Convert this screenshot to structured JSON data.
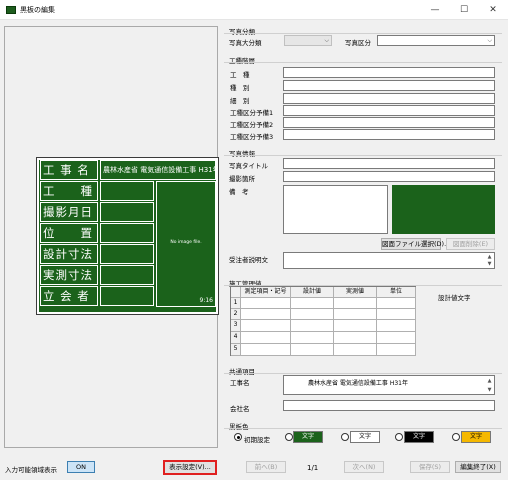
{
  "window": {
    "title": "黒板の編集",
    "minimize": "—",
    "maximize": "☐",
    "close": "✕"
  },
  "board": {
    "rows": [
      {
        "label": "工 事 名",
        "value": "農林水産省 電気通信設備工事 H31年"
      },
      {
        "label": "工　　種",
        "value": ""
      },
      {
        "label": "撮影月日",
        "value": ""
      },
      {
        "label": "位　　置",
        "value": ""
      },
      {
        "label": "設計寸法",
        "value": ""
      },
      {
        "label": "実測寸法",
        "value": ""
      },
      {
        "label": "立 会 者",
        "value": ""
      }
    ],
    "no_image_text": "No image file.",
    "scale_text": "9:16",
    "bg_color": "#1b621b"
  },
  "photo_class": {
    "section": "写真分類",
    "major_label": "写真大分類",
    "major_value": "",
    "category_label": "写真区分",
    "category_value": ""
  },
  "work_hierarchy": {
    "section": "工種階層",
    "fields": [
      {
        "label": "工　種",
        "value": ""
      },
      {
        "label": "種　別",
        "value": ""
      },
      {
        "label": "細　別",
        "value": ""
      },
      {
        "label": "工種区分予備1",
        "value": ""
      },
      {
        "label": "工種区分予備2",
        "value": ""
      },
      {
        "label": "工種区分予備3",
        "value": ""
      }
    ]
  },
  "photo_info": {
    "section": "写真情報",
    "title_label": "写真タイトル",
    "title_value": "",
    "location_label": "撮影箇所",
    "location_value": "",
    "remarks_label": "備　考",
    "select_file_button": "図面ファイル選択(D)...",
    "delete_file_button": "図面削除(E)",
    "contractor_label": "受注者説明文"
  },
  "construction_mgmt": {
    "section": "施工管理値",
    "headers": [
      "測定項目・記号",
      "設計値",
      "実測値",
      "単位"
    ],
    "rows": [
      "1",
      "2",
      "3",
      "4",
      "5"
    ],
    "design_text_label": "設計値文字"
  },
  "common": {
    "section": "共通項目",
    "work_name_label": "工事名",
    "work_name_value": "農林水産省 電気通信設備工事 H31年",
    "company_label": "会社名",
    "company_value": ""
  },
  "board_color": {
    "section": "黒板色",
    "initial_label": "初期設定",
    "swatch_text": "文字",
    "colors": {
      "green": "#1b621b",
      "white": "#ffffff",
      "black": "#000000",
      "yellow": "#f5b800"
    }
  },
  "footer": {
    "input_display_label": "入力可能領域表示",
    "on_button": "ON",
    "display_settings_button": "表示設定(V)...",
    "prev_button": "前へ(B)",
    "page_count": "1/1",
    "next_button": "次へ(N)",
    "save_button": "保存(S)",
    "finish_button": "編集終了(X)"
  }
}
